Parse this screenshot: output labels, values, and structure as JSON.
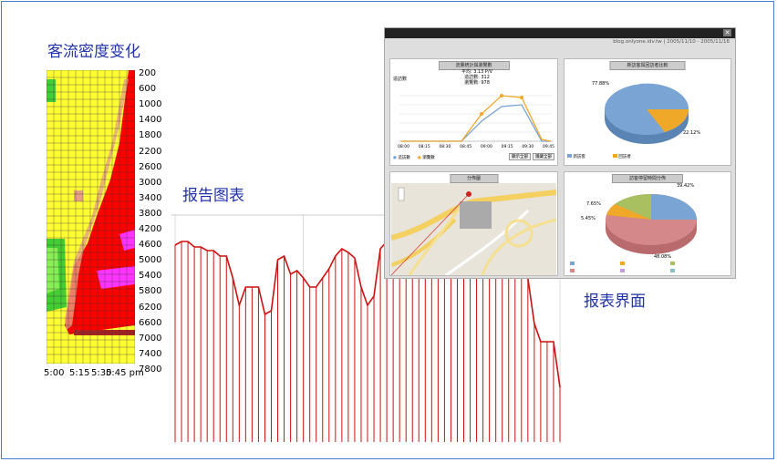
{
  "titles": {
    "density": "客流密度变化",
    "report_chart": "报告图表",
    "report_ui": "报表界面"
  },
  "heatmap": {
    "y_ticks": [
      "200",
      "600",
      "1000",
      "1400",
      "1800",
      "2200",
      "2600",
      "3000",
      "3400",
      "3800",
      "4200",
      "4600",
      "5000",
      "5400",
      "5800",
      "6200",
      "6600",
      "7000",
      "7400",
      "7800"
    ],
    "x_ticks": [
      "5:00",
      "5:15",
      "5:30",
      "5:45 pm"
    ],
    "colors": {
      "low": "#ffff33",
      "mid": "#ff0000",
      "high": "#ff33ff",
      "green": "#44cc33",
      "peach": "#e8a080"
    }
  },
  "line_chart": {
    "color": "#cc1111",
    "values": [
      78,
      80,
      80,
      77,
      77,
      75,
      75,
      72,
      72,
      60,
      45,
      55,
      55,
      55,
      40,
      42,
      70,
      72,
      62,
      64,
      60,
      55,
      55,
      60,
      65,
      72,
      76,
      74,
      71,
      55,
      45,
      50,
      76,
      80,
      80,
      60,
      60,
      60,
      60,
      60,
      60,
      60,
      60,
      60,
      60,
      60,
      60,
      60,
      60,
      60,
      60,
      60,
      60,
      60,
      60,
      60,
      35,
      25,
      25,
      25,
      0
    ]
  },
  "report": {
    "url": "blog.onlyone.idv.tw  |  2005/11/10 - 2005/11/16",
    "line_panel": {
      "title": "流量統計與瀏覽數",
      "avg": "平均: 3.13 P/V",
      "visits": "造訪數: 312",
      "views": "瀏覽數: 978",
      "ylabel": "造訪數",
      "x_ticks": [
        "08:00",
        "08:15",
        "08:30",
        "08:45",
        "09:00",
        "09:15",
        "09:30",
        "09:45"
      ],
      "legend": [
        "造訪數",
        "瀏覽數"
      ],
      "buttons": [
        "顯示全部",
        "隱藏全部"
      ]
    },
    "pie1": {
      "title": "新訪客與回訪者比較",
      "slices": [
        {
          "label": "新訪客",
          "value": 77.88,
          "color": "#7aa4d4"
        },
        {
          "label": "回訪者",
          "value": 22.12,
          "color": "#f0a828"
        }
      ],
      "labels": [
        "77.88%",
        "22.12%"
      ]
    },
    "map_panel": {
      "title": "分佈圖"
    },
    "pie2": {
      "title": "訪客停留時間分佈",
      "slices": [
        {
          "value": 39.42,
          "color": "#7aa4d4"
        },
        {
          "value": 7.65,
          "color": "#a8c060"
        },
        {
          "value": 5.45,
          "color": "#f0a828"
        },
        {
          "value": 48.08,
          "color": "#d4888a"
        }
      ],
      "labels": [
        "39.42%",
        "7.65%",
        "5.45%",
        "48.08%"
      ]
    }
  }
}
